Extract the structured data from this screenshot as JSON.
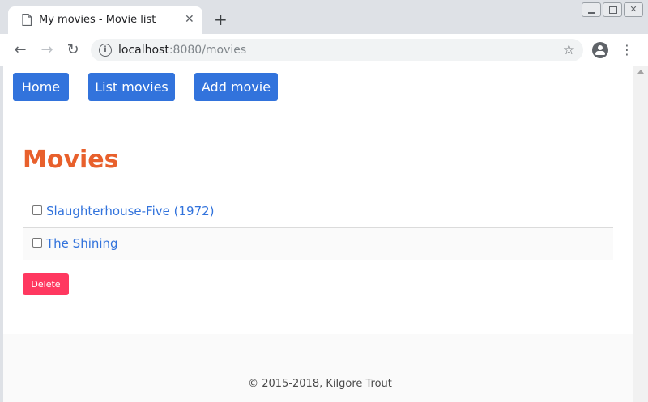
{
  "browser": {
    "tab_title": "My movies - Movie list",
    "tab_close": "✕",
    "new_tab": "+",
    "url_host": "localhost",
    "url_rest": ":8080/movies"
  },
  "nav": {
    "home": "Home",
    "list_movies": "List movies",
    "add_movie": "Add movie"
  },
  "page": {
    "title": "Movies"
  },
  "movies": [
    {
      "title": "Slaughterhouse-Five (1972)",
      "checked": false
    },
    {
      "title": "The Shining",
      "checked": false
    }
  ],
  "actions": {
    "delete": "Delete"
  },
  "footer": {
    "text": "© 2015-2018, Kilgore Trout"
  },
  "colors": {
    "primary": "#3273dc",
    "title": "#e8602c",
    "danger": "#ff3860"
  }
}
